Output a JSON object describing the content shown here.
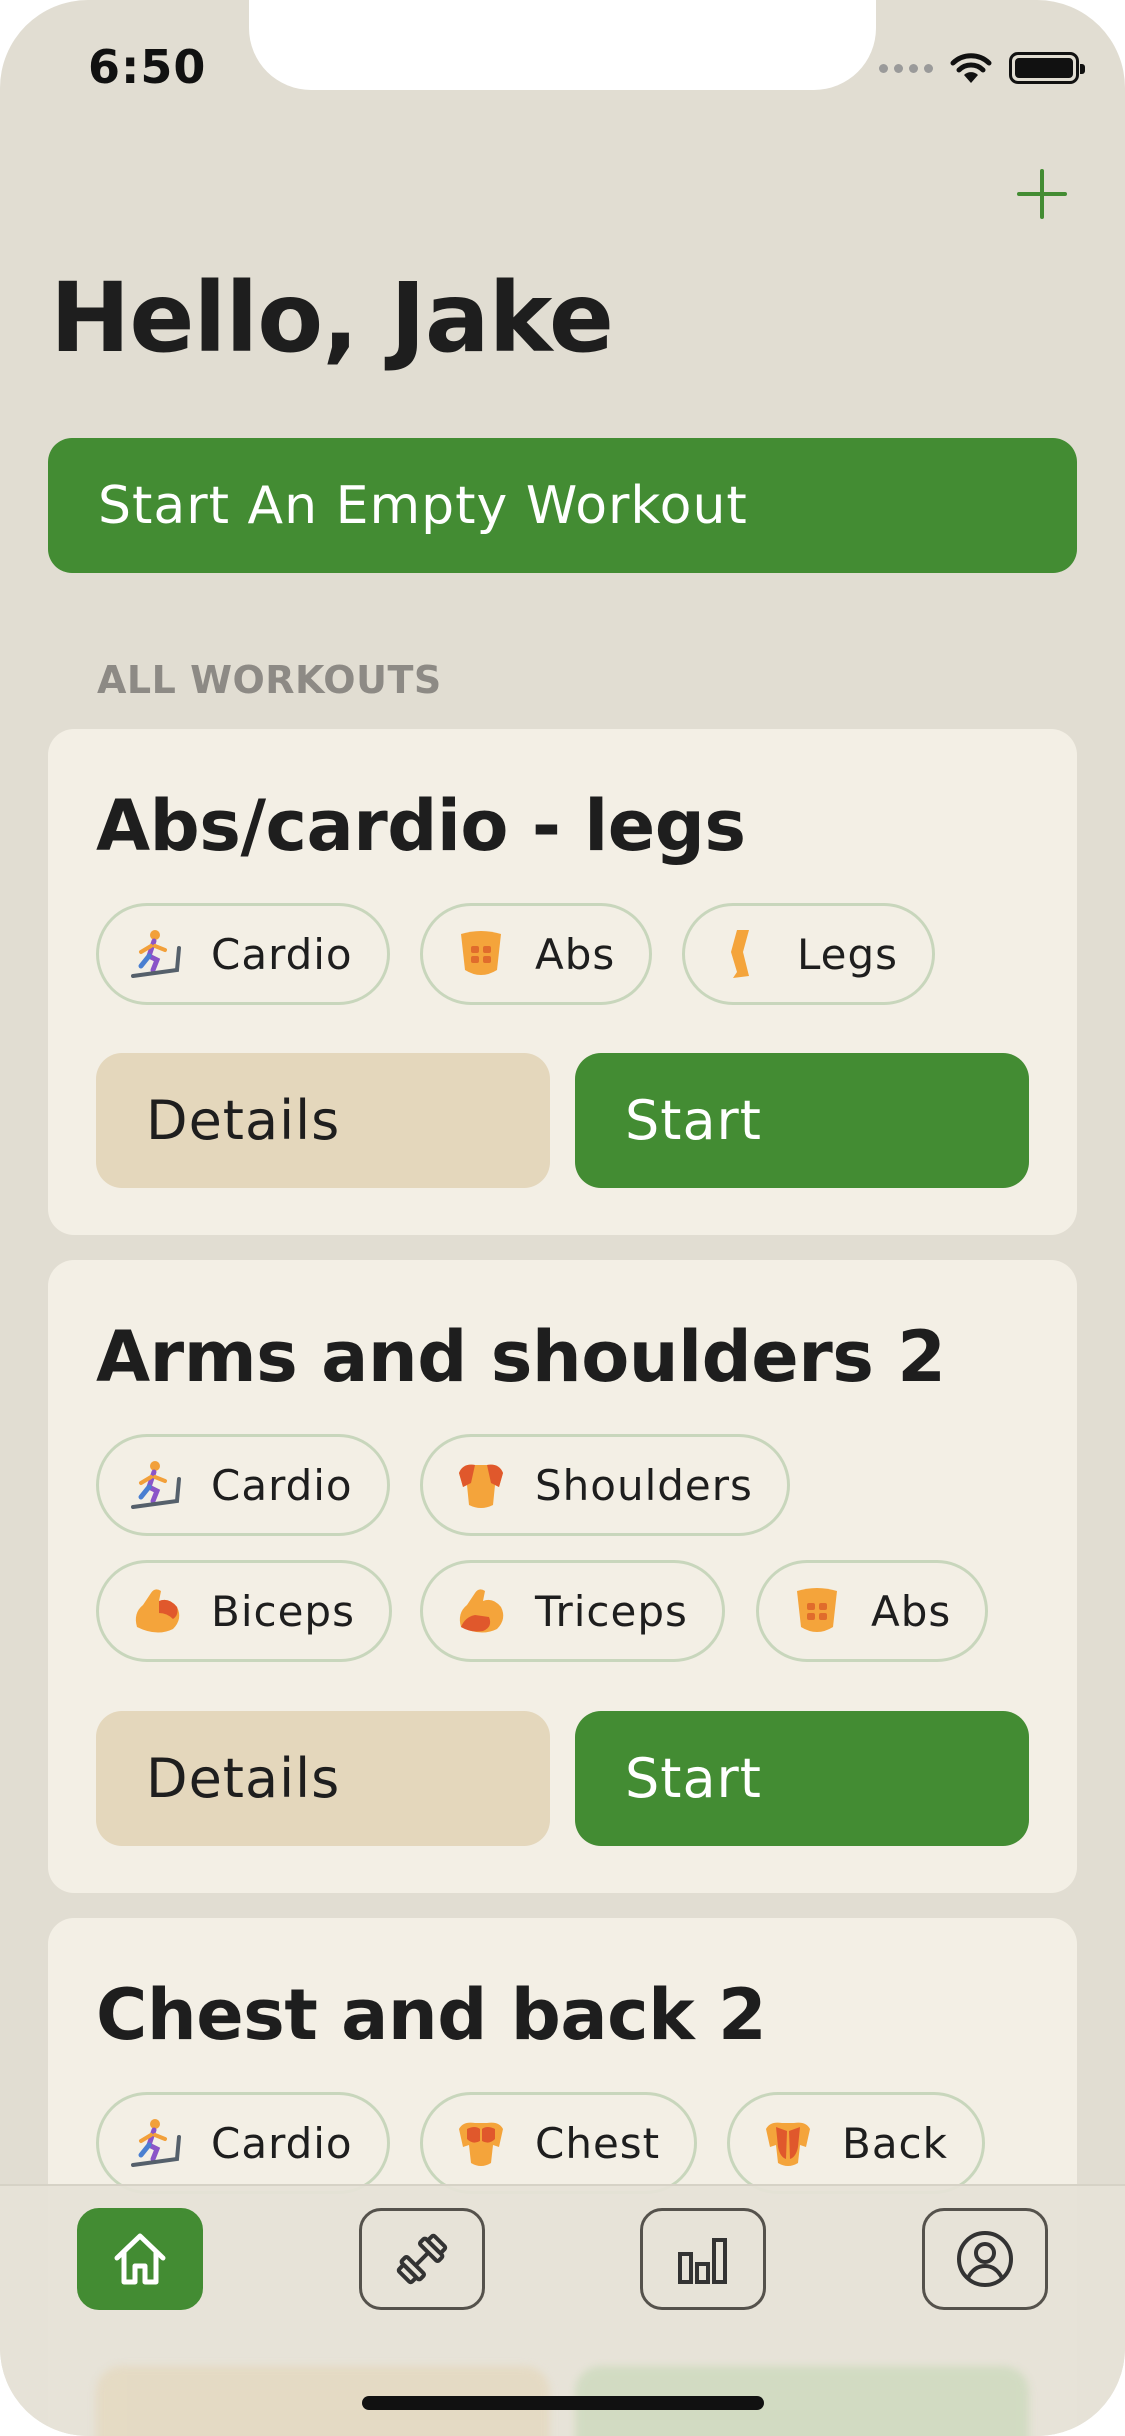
{
  "status_bar": {
    "time": "6:50"
  },
  "header": {
    "greeting": "Hello, Jake",
    "add_icon": "plus-icon"
  },
  "empty_workout_button": "Start An Empty Workout",
  "section_title": "ALL WORKOUTS",
  "workouts": [
    {
      "title": "Abs/cardio - legs",
      "tags": [
        {
          "label": "Cardio",
          "icon": "treadmill-icon"
        },
        {
          "label": "Abs",
          "icon": "abs-icon"
        },
        {
          "label": "Legs",
          "icon": "leg-icon"
        }
      ],
      "details_label": "Details",
      "start_label": "Start"
    },
    {
      "title": "Arms and shoulders 2",
      "tags": [
        {
          "label": "Cardio",
          "icon": "treadmill-icon"
        },
        {
          "label": "Shoulders",
          "icon": "shoulders-icon"
        },
        {
          "label": "Biceps",
          "icon": "biceps-icon"
        },
        {
          "label": "Triceps",
          "icon": "triceps-icon"
        },
        {
          "label": "Abs",
          "icon": "abs-icon"
        }
      ],
      "details_label": "Details",
      "start_label": "Start"
    },
    {
      "title": "Chest and back 2",
      "tags": [
        {
          "label": "Cardio",
          "icon": "treadmill-icon"
        },
        {
          "label": "Chest",
          "icon": "chest-icon"
        },
        {
          "label": "Back",
          "icon": "back-icon"
        }
      ]
    }
  ],
  "tab_bar": [
    {
      "name": "home",
      "icon": "home-icon",
      "active": true
    },
    {
      "name": "workouts",
      "icon": "dumbbell-icon",
      "active": false
    },
    {
      "name": "stats",
      "icon": "bar-chart-icon",
      "active": false
    },
    {
      "name": "profile",
      "icon": "profile-icon",
      "active": false
    }
  ],
  "colors": {
    "accent": "#438c33",
    "background": "#e1ddd2",
    "card": "#f3efe5",
    "details_button": "#e4d7bc",
    "chip_border": "#c8d6bc"
  }
}
